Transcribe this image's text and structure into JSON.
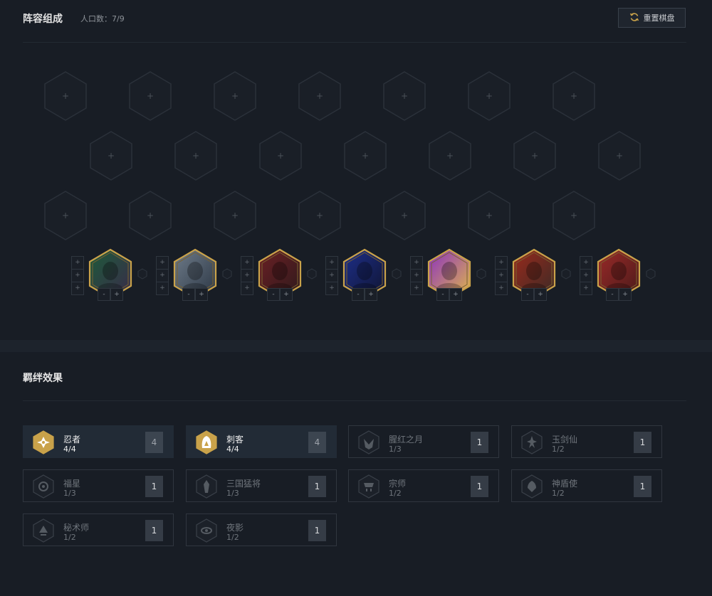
{
  "lineup": {
    "title": "阵容组成",
    "population": "人口数：7/9",
    "reset_label": "重置棋盘"
  },
  "board": {
    "empty_slot_symbol": "+",
    "rows": 3,
    "slots_per_row": 7
  },
  "bench": {
    "star_symbol": "+",
    "item_minus": "-",
    "item_plus": "+",
    "champions": [
      {
        "name": "champion-1",
        "palette": [
          "#1d5b3a",
          "#3a2a4a"
        ]
      },
      {
        "name": "champion-2",
        "palette": [
          "#6f7c8a",
          "#2b3644"
        ]
      },
      {
        "name": "champion-3",
        "palette": [
          "#6b1f24",
          "#2e1a1c"
        ]
      },
      {
        "name": "champion-4",
        "palette": [
          "#1e2f8a",
          "#0f1430"
        ]
      },
      {
        "name": "champion-5",
        "palette": [
          "#8a2fc2",
          "#e0b84a"
        ]
      },
      {
        "name": "champion-6",
        "palette": [
          "#9a2a1c",
          "#3a2a26"
        ]
      },
      {
        "name": "champion-7",
        "palette": [
          "#9a2a28",
          "#4a1a1a"
        ]
      }
    ]
  },
  "synergy": {
    "title": "羁绊效果",
    "traits": [
      {
        "name": "忍者",
        "count": "4/4",
        "level": "4",
        "active": true,
        "icon": "shuriken-icon"
      },
      {
        "name": "刺客",
        "count": "4/4",
        "level": "4",
        "active": true,
        "icon": "assassin-hood-icon"
      },
      {
        "name": "腥红之月",
        "count": "1/3",
        "level": "1",
        "active": false,
        "icon": "moon-mask-icon"
      },
      {
        "name": "玉剑仙",
        "count": "1/2",
        "level": "1",
        "active": false,
        "icon": "jade-sword-icon"
      },
      {
        "name": "福星",
        "count": "1/3",
        "level": "1",
        "active": false,
        "icon": "fortune-coin-icon"
      },
      {
        "name": "三国猛将",
        "count": "1/3",
        "level": "1",
        "active": false,
        "icon": "warlord-crest-icon"
      },
      {
        "name": "宗师",
        "count": "1/2",
        "level": "1",
        "active": false,
        "icon": "master-icon"
      },
      {
        "name": "神盾使",
        "count": "1/2",
        "level": "1",
        "active": false,
        "icon": "aegis-icon"
      },
      {
        "name": "秘术师",
        "count": "1/2",
        "level": "1",
        "active": false,
        "icon": "mystic-icon"
      },
      {
        "name": "夜影",
        "count": "1/2",
        "level": "1",
        "active": false,
        "icon": "dusk-eye-icon"
      }
    ]
  },
  "colors": {
    "gold": "#c9a24a",
    "panel": "#181d25",
    "active_trait_bg": "#222b36"
  }
}
